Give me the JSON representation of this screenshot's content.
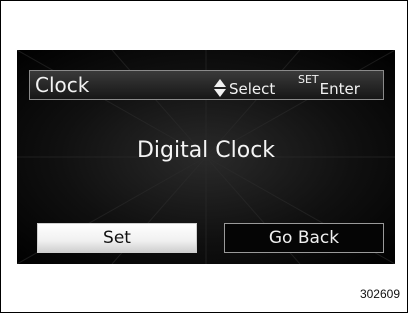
{
  "header": {
    "title": "Clock",
    "select_hint": "Select",
    "set_label": "SET",
    "enter_hint": "Enter"
  },
  "main": {
    "text": "Digital Clock"
  },
  "buttons": {
    "set_label": "Set",
    "go_back_label": "Go Back"
  },
  "figure_code": "302609"
}
